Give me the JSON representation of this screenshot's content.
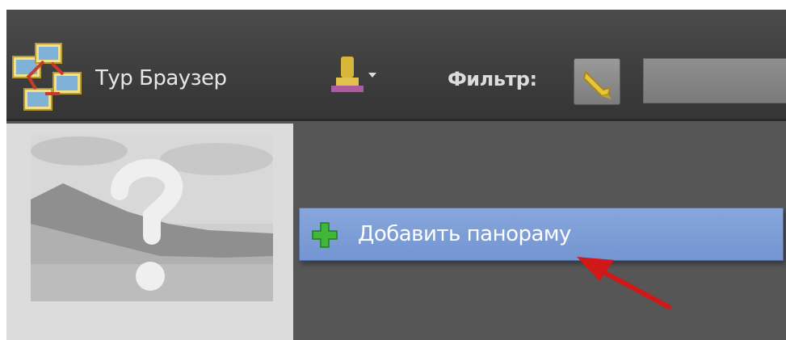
{
  "app": {
    "title": "Тур Браузер"
  },
  "toolbar": {
    "filter_label": "Фильтр:",
    "filter_value": ""
  },
  "menu": {
    "add_panorama_label": "Добавить панораму"
  },
  "icons": {
    "logo": "tour-browser-logo-icon",
    "stamp": "stamp-icon",
    "filter": "filter-pencil-icon",
    "plus": "plus-icon",
    "pointer": "red-arrow-annotation"
  },
  "colors": {
    "toolbar_bg": "#3b3b3b",
    "workspace_bg": "#565656",
    "menu_highlight": "#7a9ad6",
    "annotation_arrow": "#d01818"
  }
}
